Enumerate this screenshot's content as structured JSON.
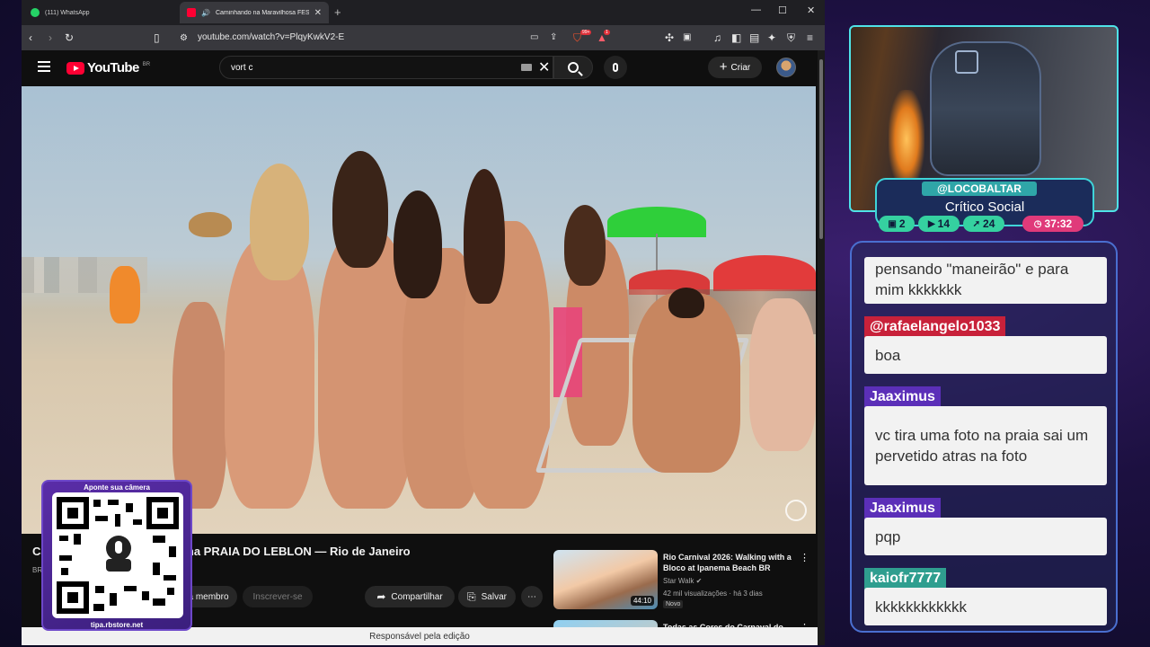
{
  "browser": {
    "tabs": [
      {
        "title": "(111) WhatsApp",
        "active": false
      },
      {
        "title": "Caminhando na Maravilhosa FESTA",
        "active": true
      }
    ],
    "url": "youtube.com/watch?v=PlqyKwkV2-E",
    "badges": {
      "brave": "99+",
      "alert": "1"
    }
  },
  "youtube": {
    "logo_text": "YouTube",
    "country": "BR",
    "search_value": "vort c",
    "create_label": "Criar",
    "video_title": "Ca... FESTA DE CARNAVAL na PRAIA DO LEBLON — Rio de Janeiro",
    "channel_badge": "BR",
    "member_label": "a membro",
    "subscribe_label": "Inscrever-se",
    "share_label": "Compartilhar",
    "save_label": "Salvar",
    "recommendations": [
      {
        "title": "Rio Carnival 2026: Walking with a Bloco at Ipanema Beach BR",
        "channel": "Star Walk",
        "views": "42 mil visualizações · há 3 dias",
        "duration": "44:10",
        "badge": "Novo"
      },
      {
        "title": "Todas as Cores do Carnaval do"
      }
    ],
    "status_bar": "Responsável pela edição"
  },
  "qr": {
    "top_text": "Aponte sua câmera",
    "bottom_text": "tipa.rbstore.net"
  },
  "stream": {
    "handle": "@LOCOBALTAR",
    "subtitle": "Crítico Social",
    "stats": [
      {
        "icon": "chat",
        "value": "2"
      },
      {
        "icon": "video",
        "value": "14"
      },
      {
        "icon": "rocket",
        "value": "24"
      },
      {
        "icon": "clock",
        "value": "37:32"
      }
    ]
  },
  "chat": {
    "messages": [
      {
        "user": "",
        "text": "pensando \"maneirão\" e para mim kkkkkkk"
      },
      {
        "user": "@rafaelangelo1033",
        "text": "boa"
      },
      {
        "user": "Jaaximus",
        "text": "vc tira uma foto na praia sai um pervetido atras na foto"
      },
      {
        "user": "Jaaximus",
        "text": "pqp"
      },
      {
        "user": "kaiofr7777",
        "text": "kkkkkkkkkkkk"
      }
    ]
  },
  "colors": {
    "accent_teal": "#4fe3e8",
    "youtube_red": "#ff0033",
    "chat_user_purple": "#5b2fb8",
    "chat_user_red": "#c8213a",
    "chat_user_teal": "#2f9e8f"
  }
}
